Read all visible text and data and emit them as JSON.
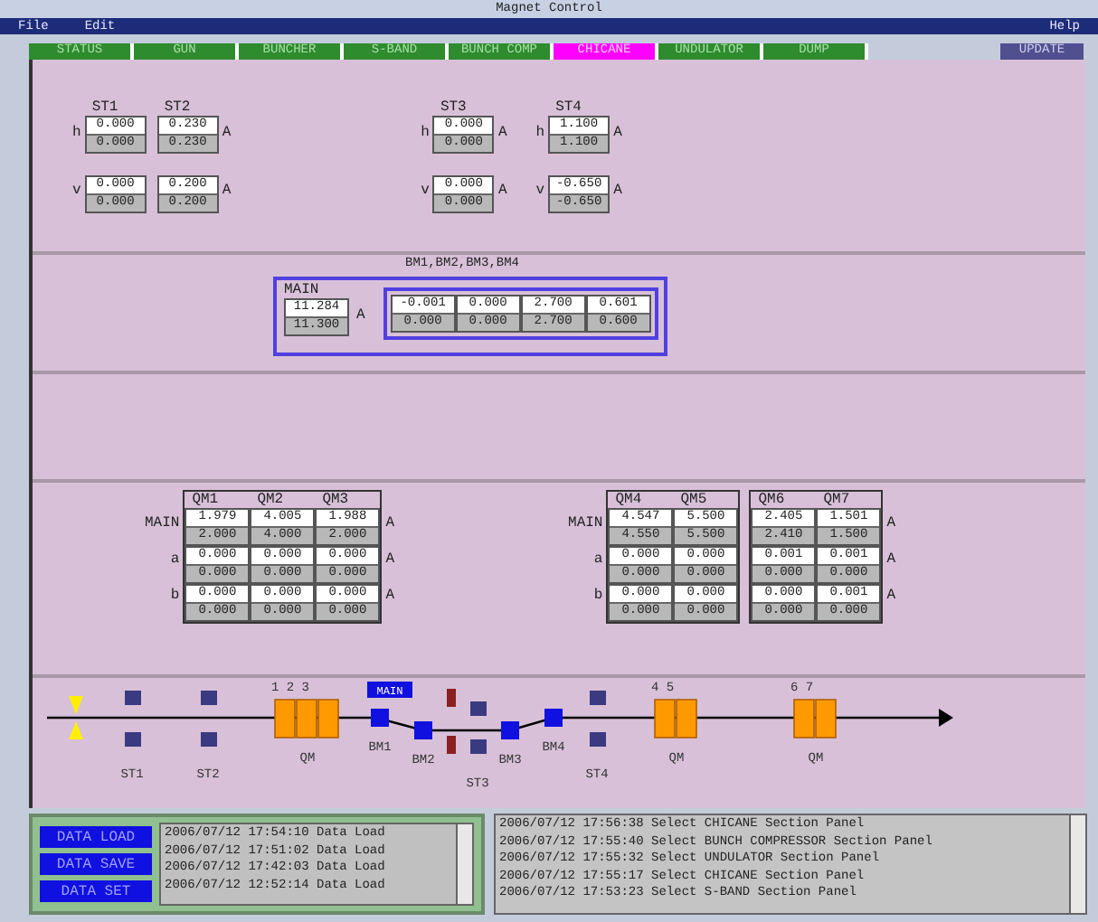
{
  "window": {
    "title": "Magnet Control"
  },
  "menu": {
    "left": [
      "File",
      "Edit"
    ],
    "right": [
      "Help"
    ]
  },
  "tabs": [
    {
      "label": "STATUS",
      "selected": false
    },
    {
      "label": "GUN",
      "selected": false
    },
    {
      "label": "BUNCHER",
      "selected": false
    },
    {
      "label": "S-BAND",
      "selected": false
    },
    {
      "label": "BUNCH COMP",
      "selected": false
    },
    {
      "label": "CHICANE",
      "selected": true
    },
    {
      "label": "UNDULATOR",
      "selected": false
    },
    {
      "label": "DUMP",
      "selected": false
    }
  ],
  "update_button": "UPDATE",
  "steering": {
    "groups": [
      {
        "rows": [
          {
            "label": "h",
            "unit": "A"
          },
          {
            "label": "v",
            "unit": "A"
          }
        ],
        "blocks": [
          {
            "magnets": [
              {
                "name": "ST1",
                "values": [
                  {
                    "read": "0.000",
                    "set": "0.000"
                  },
                  {
                    "read": "0.000",
                    "set": "0.000"
                  }
                ]
              },
              {
                "name": "ST2",
                "values": [
                  {
                    "read": "0.230",
                    "set": "0.230"
                  },
                  {
                    "read": "0.200",
                    "set": "0.200"
                  }
                ]
              }
            ]
          }
        ]
      },
      {
        "rows": [
          {
            "label": "h",
            "unit": "A"
          },
          {
            "label": "v",
            "unit": "A"
          }
        ],
        "blocks": [
          {
            "magnets": [
              {
                "name": "ST3",
                "values": [
                  {
                    "read": "0.000",
                    "set": "0.000"
                  },
                  {
                    "read": "0.000",
                    "set": "0.000"
                  }
                ]
              }
            ]
          }
        ]
      },
      {
        "rows": [
          {
            "label": "h",
            "unit": "A"
          },
          {
            "label": "v",
            "unit": "A"
          }
        ],
        "blocks": [
          {
            "magnets": [
              {
                "name": "ST4",
                "values": [
                  {
                    "read": "1.100",
                    "set": "1.100"
                  },
                  {
                    "read": "-0.650",
                    "set": "-0.650"
                  }
                ]
              }
            ]
          }
        ]
      }
    ]
  },
  "bending": {
    "title": "BM1,BM2,BM3,BM4",
    "main": {
      "label": "MAIN",
      "read": "11.284",
      "set": "11.300",
      "unit": "A"
    },
    "trims": [
      {
        "read": "-0.001",
        "set": "0.000"
      },
      {
        "read": "0.000",
        "set": "0.000"
      },
      {
        "read": "2.700",
        "set": "2.700"
      },
      {
        "read": "0.601",
        "set": "0.600"
      }
    ]
  },
  "quadrupoles": {
    "groups": [
      {
        "rows": [
          {
            "label": "MAIN",
            "unit": "A"
          },
          {
            "label": "a",
            "unit": "A"
          },
          {
            "label": "b",
            "unit": "A"
          }
        ],
        "blocks": [
          {
            "magnets": [
              {
                "name": "QM1",
                "values": [
                  {
                    "read": "1.979",
                    "set": "2.000"
                  },
                  {
                    "read": "0.000",
                    "set": "0.000"
                  },
                  {
                    "read": "0.000",
                    "set": "0.000"
                  }
                ]
              },
              {
                "name": "QM2",
                "values": [
                  {
                    "read": "4.005",
                    "set": "4.000"
                  },
                  {
                    "read": "0.000",
                    "set": "0.000"
                  },
                  {
                    "read": "0.000",
                    "set": "0.000"
                  }
                ]
              },
              {
                "name": "QM3",
                "values": [
                  {
                    "read": "1.988",
                    "set": "2.000"
                  },
                  {
                    "read": "0.000",
                    "set": "0.000"
                  },
                  {
                    "read": "0.000",
                    "set": "0.000"
                  }
                ]
              }
            ]
          }
        ]
      },
      {
        "rows": [
          {
            "label": "MAIN",
            "unit": "A"
          },
          {
            "label": "a",
            "unit": "A"
          },
          {
            "label": "b",
            "unit": "A"
          }
        ],
        "blocks": [
          {
            "magnets": [
              {
                "name": "QM4",
                "values": [
                  {
                    "read": "4.547",
                    "set": "4.550"
                  },
                  {
                    "read": "0.000",
                    "set": "0.000"
                  },
                  {
                    "read": "0.000",
                    "set": "0.000"
                  }
                ]
              },
              {
                "name": "QM5",
                "values": [
                  {
                    "read": "5.500",
                    "set": "5.500"
                  },
                  {
                    "read": "0.000",
                    "set": "0.000"
                  },
                  {
                    "read": "0.000",
                    "set": "0.000"
                  }
                ]
              }
            ]
          },
          {
            "magnets": [
              {
                "name": "QM6",
                "values": [
                  {
                    "read": "2.405",
                    "set": "2.410"
                  },
                  {
                    "read": "0.001",
                    "set": "0.000"
                  },
                  {
                    "read": "0.000",
                    "set": "0.000"
                  }
                ]
              },
              {
                "name": "QM7",
                "values": [
                  {
                    "read": "1.501",
                    "set": "1.500"
                  },
                  {
                    "read": "0.001",
                    "set": "0.000"
                  },
                  {
                    "read": "0.001",
                    "set": "0.000"
                  }
                ]
              }
            ]
          }
        ]
      }
    ]
  },
  "beamline": {
    "steerer_labels": [
      "ST1",
      "ST2",
      "ST3",
      "ST4"
    ],
    "bend_labels": [
      "BM1",
      "BM2",
      "BM3",
      "BM4"
    ],
    "main_badge": "MAIN",
    "quad_groups": [
      {
        "numbers": "1 2 3",
        "label": "QM"
      },
      {
        "numbers": "4 5",
        "label": "QM"
      },
      {
        "numbers": "6 7",
        "label": "QM"
      }
    ]
  },
  "data_buttons": [
    "DATA LOAD",
    "DATA SAVE",
    "DATA SET"
  ],
  "data_log": [
    "2006/07/12 17:54:10 Data Load",
    "2006/07/12 17:51:02 Data Load",
    "2006/07/12 17:42:03 Data Load",
    "2006/07/12 12:52:14 Data Load"
  ],
  "event_log": [
    "2006/07/12 17:56:38 Select CHICANE Section Panel",
    "2006/07/12 17:55:40 Select BUNCH COMPRESSOR Section Panel",
    "2006/07/12 17:55:32 Select UNDULATOR Section Panel",
    "2006/07/12 17:55:17 Select CHICANE Section Panel",
    "2006/07/12 17:53:23 Select S-BAND Section Panel"
  ]
}
